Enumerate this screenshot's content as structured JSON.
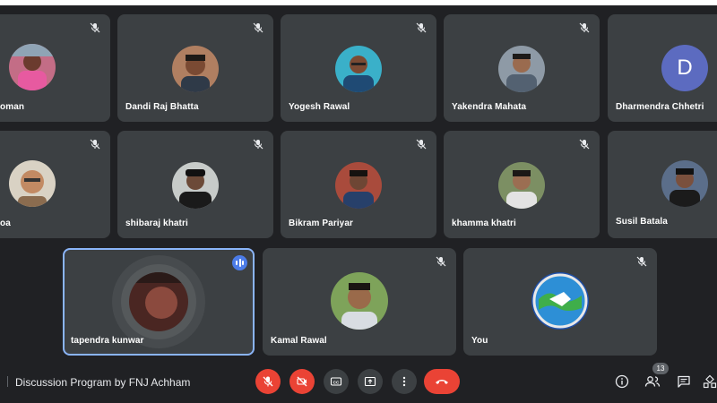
{
  "participants": [
    {
      "name": "oman",
      "muted": true
    },
    {
      "name": "Dandi Raj Bhatta",
      "muted": true
    },
    {
      "name": "Yogesh Rawal",
      "muted": true
    },
    {
      "name": "Yakendra Mahata",
      "muted": true
    },
    {
      "name": "Dharmendra Chhetri",
      "muted": false,
      "initial": "D"
    },
    {
      "name": "oa",
      "muted": true
    },
    {
      "name": "shibaraj khatri",
      "muted": true
    },
    {
      "name": "Bikram Pariyar",
      "muted": true
    },
    {
      "name": "khamma khatri",
      "muted": true
    },
    {
      "name": "Susil Batala",
      "muted": false
    },
    {
      "name": "tapendra kunwar",
      "speaking": true
    },
    {
      "name": "Kamal Rawal",
      "muted": true
    },
    {
      "name": "You",
      "muted": true
    }
  ],
  "meeting": {
    "title": "Discussion Program by FNJ Achham"
  },
  "people_count": "13",
  "colors": {
    "background": "#202124",
    "tile": "#3c4043",
    "accent": "#8ab4f8",
    "danger": "#ea4335",
    "avatar_D": "#5c6bc0"
  },
  "icons": [
    "mic-off-icon",
    "camera-off-icon",
    "captions-icon",
    "present-icon",
    "more-icon",
    "end-call-icon",
    "info-icon",
    "people-icon",
    "chat-icon",
    "activities-icon"
  ]
}
